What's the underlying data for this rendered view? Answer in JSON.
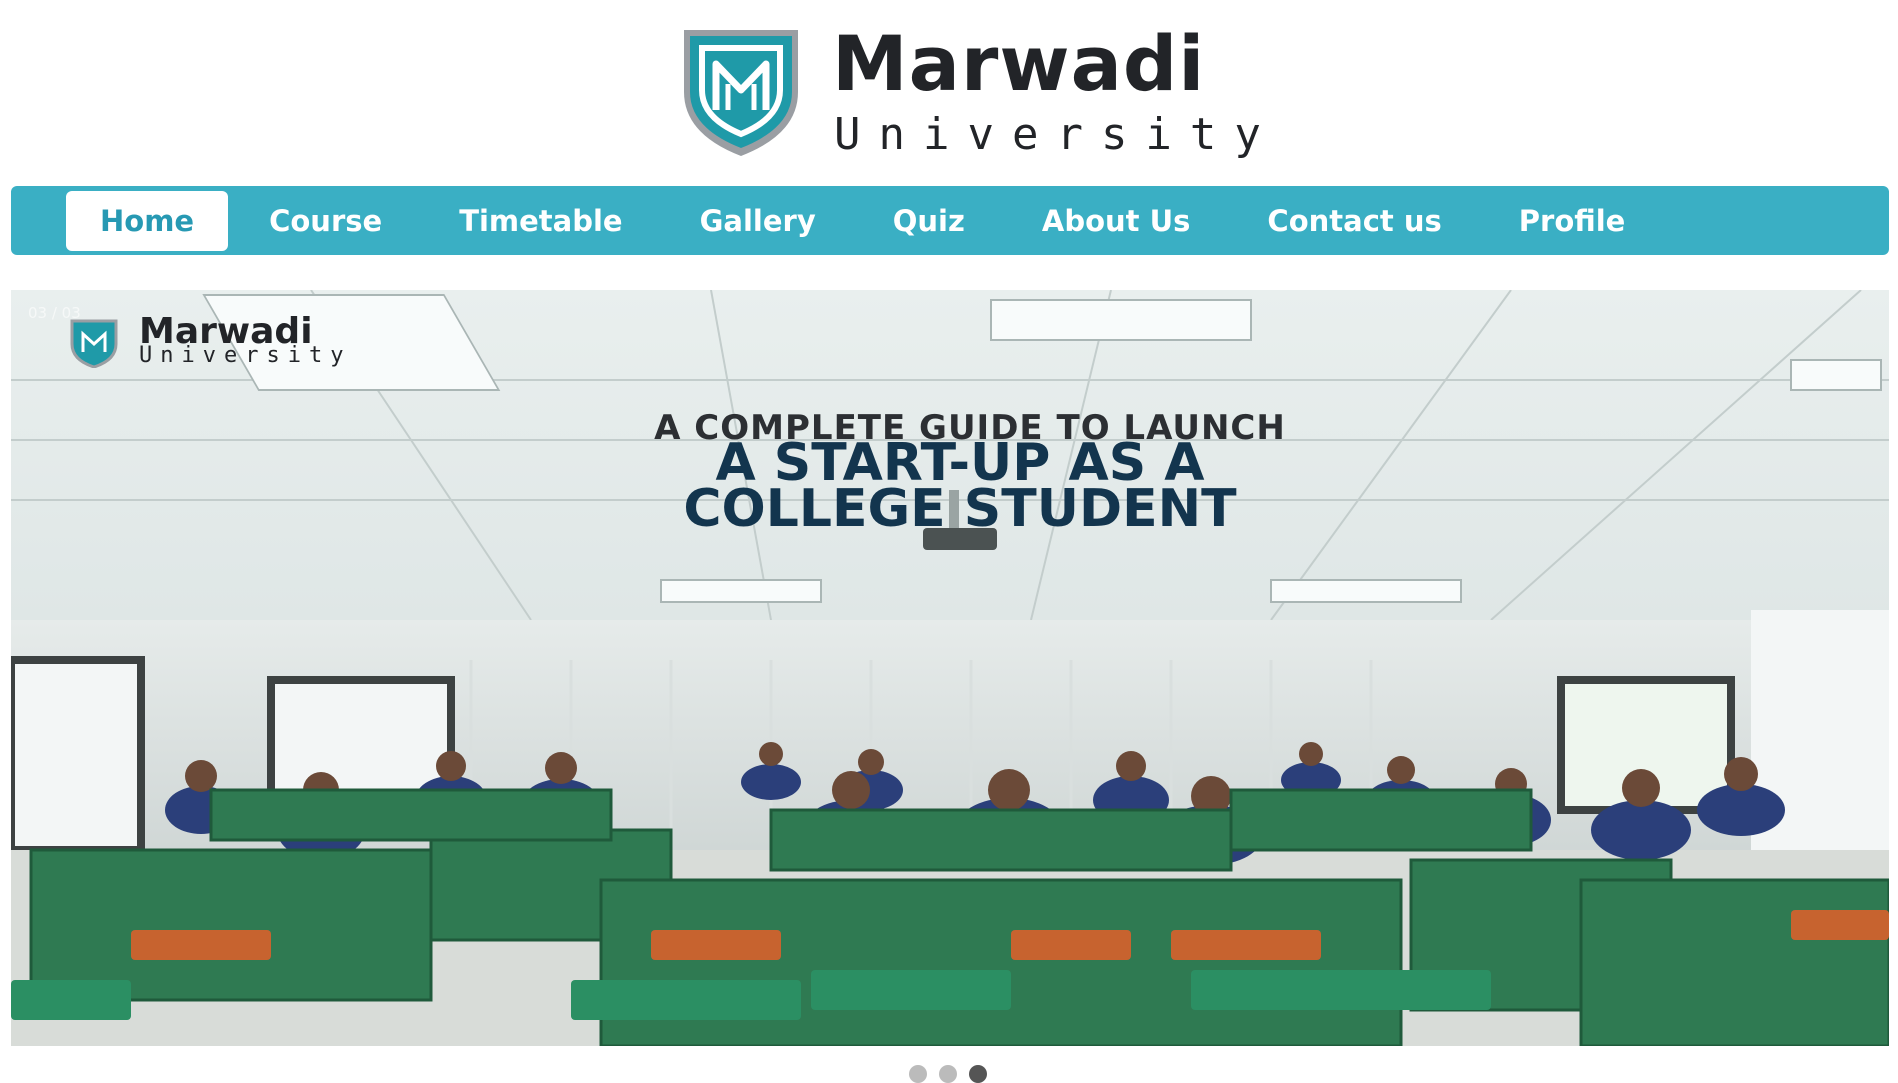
{
  "brand": {
    "logo_line1": "Marwadi",
    "logo_line2": "University",
    "primary_color": "#3aafc4",
    "crest_color": "#1e9aa8"
  },
  "nav": {
    "items": [
      {
        "label": "Home",
        "active": true
      },
      {
        "label": "Course",
        "active": false
      },
      {
        "label": "Timetable",
        "active": false
      },
      {
        "label": "Gallery",
        "active": false
      },
      {
        "label": "Quiz",
        "active": false
      },
      {
        "label": "About Us",
        "active": false
      },
      {
        "label": "Contact us",
        "active": false
      },
      {
        "label": "Profile",
        "active": false
      }
    ]
  },
  "slider": {
    "counter": "03 / 03",
    "slide": {
      "logo_line1": "Marwadi",
      "logo_line2": "University",
      "headline_line1": "A COMPLETE GUIDE TO LAUNCH",
      "headline_line2": "A START-UP AS A",
      "headline_line3": "COLLEGE STUDENT"
    },
    "dots": 3,
    "active_dot": 3
  }
}
